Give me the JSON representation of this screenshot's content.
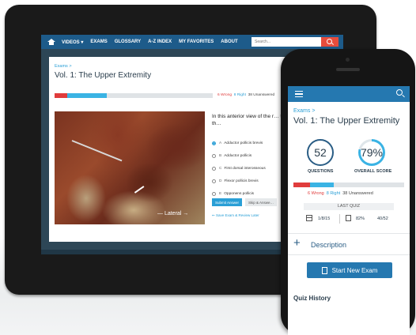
{
  "tablet": {
    "nav": {
      "items": [
        "VIDEOS ▾",
        "EXAMS",
        "GLOSSARY",
        "A-Z INDEX",
        "MY FAVORITES",
        "ABOUT"
      ],
      "search_placeholder": "Search..."
    },
    "breadcrumb": "Exams >",
    "title": "Vol. 1: The Upper Extremity",
    "stats": {
      "wrong": "6 Wrong",
      "right": "8 Right",
      "unanswered": "38 Unanswered"
    },
    "progress": {
      "wrong_fraction": 0.077,
      "right_fraction": 0.154
    },
    "image_label": "— Lateral →",
    "question": "In this anterior view of the r… the muscle indicated by th…",
    "options": [
      {
        "letter": "A",
        "text": "Adductor pollicis brevis"
      },
      {
        "letter": "B",
        "text": "Adductor pollicis"
      },
      {
        "letter": "C",
        "text": "First dorsal interosseous"
      },
      {
        "letter": "D",
        "text": "Flexor pollicis brevis"
      },
      {
        "letter": "E",
        "text": "Opponens pollicis"
      }
    ],
    "submit_label": "Submit Answer",
    "skip_label": "Skip & Answe…",
    "save_label": "Save Exam & Review Later"
  },
  "phone": {
    "breadcrumb": "Exams >",
    "title": "Vol. 1: The Upper Extremity",
    "questions_value": "52",
    "questions_label": "QUESTIONS",
    "score_value": "79%",
    "score_fraction": 0.79,
    "score_label": "OVERALL SCORE",
    "stats": {
      "wrong": "6 Wrong",
      "right": "8 Right",
      "unanswered": "38 Unanswered"
    },
    "last_quiz": {
      "label": "LAST QUIZ",
      "date": "1/8/15",
      "percent": "82%",
      "score": "40/52"
    },
    "description_label": "Description",
    "start_label": "Start New Exam",
    "history_label": "Quiz History"
  },
  "colors": {
    "accent": "#2578b0",
    "wrong": "#e03c3c",
    "right": "#3ab3e4",
    "search_button": "#e74c3c"
  }
}
